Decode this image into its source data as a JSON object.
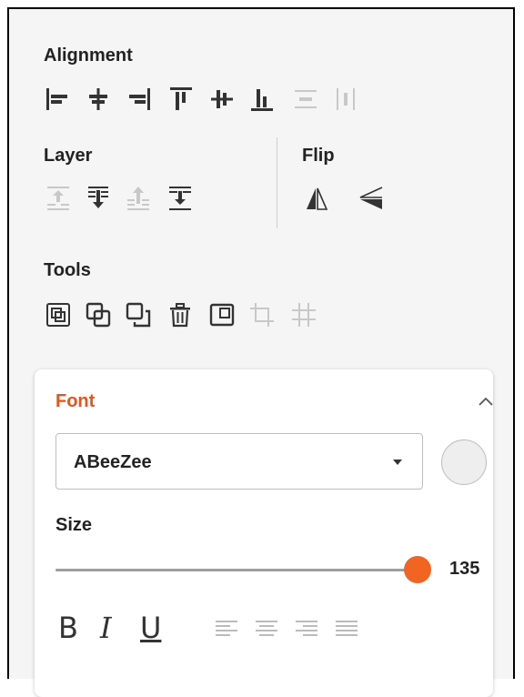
{
  "alignment": {
    "title": "Alignment",
    "icons": [
      "align-left-icon",
      "align-center-horizontal-icon",
      "align-right-icon",
      "align-top-icon",
      "align-middle-vertical-icon",
      "align-bottom-icon",
      "distribute-horizontal-icon",
      "distribute-vertical-icon"
    ]
  },
  "layer": {
    "title": "Layer",
    "icons": [
      "bring-to-front-icon",
      "send-to-back-icon",
      "bring-forward-icon",
      "send-backward-icon"
    ]
  },
  "flip": {
    "title": "Flip",
    "icons": [
      "flip-horizontal-icon",
      "flip-vertical-icon"
    ]
  },
  "tools": {
    "title": "Tools",
    "icons": [
      "group-icon",
      "ungroup-icon",
      "duplicate-icon",
      "delete-icon",
      "resize-icon",
      "crop-icon",
      "grid-icon"
    ]
  },
  "font": {
    "title": "Font",
    "selected_font": "ABeeZee",
    "size_label": "Size",
    "size_value": "135",
    "slider_fraction": 1.0,
    "format": {
      "bold": "B",
      "italic": "I",
      "underline": "U"
    },
    "align_icons": [
      "text-align-left-icon",
      "text-align-center-icon",
      "text-align-right-icon",
      "text-align-justify-icon"
    ]
  },
  "colors": {
    "accent": "#f26422",
    "title_accent": "#e8531c",
    "disabled": "#c8c8c8",
    "icon": "#333333",
    "swatch": "#eeeeee"
  }
}
